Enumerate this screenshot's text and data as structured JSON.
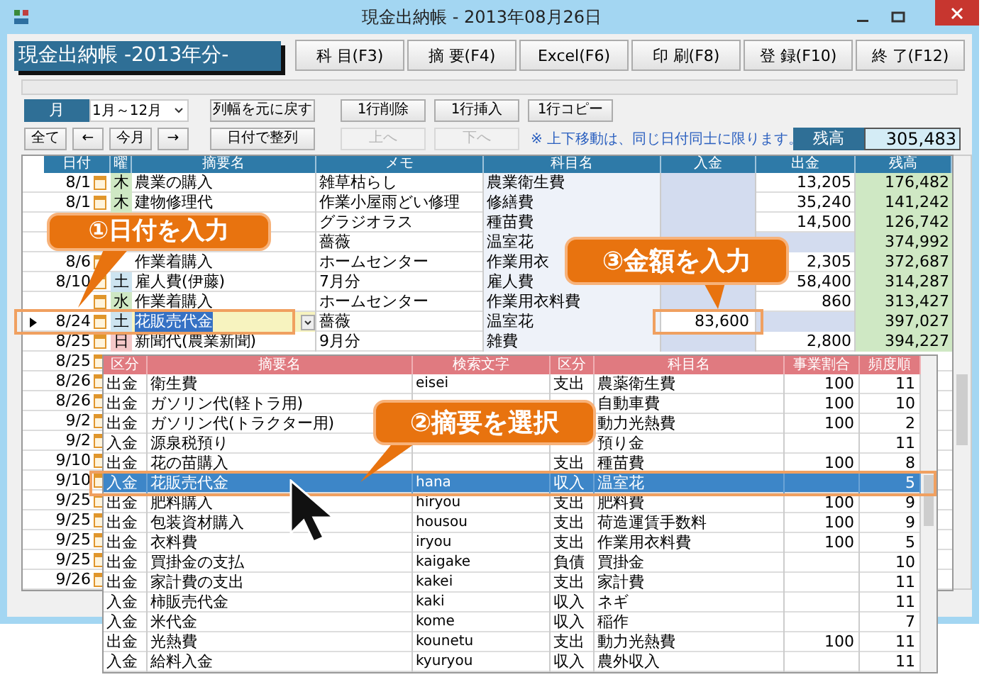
{
  "window": {
    "title": "現金出納帳 - 2013年08月26日"
  },
  "header": {
    "title": "現金出納帳 -2013年分-",
    "buttons": [
      "科 目(F3)",
      "摘 要(F4)",
      "Excel(F6)",
      "印 刷(F8)",
      "登 録(F10)",
      "終 了(F12)"
    ]
  },
  "toolbar": {
    "period_label": "月",
    "period_select": "1月～12月",
    "row1": [
      {
        "label": "列幅を元に戻す",
        "disabled": false
      },
      {
        "label": "1行削除",
        "disabled": false
      },
      {
        "label": "1行挿入",
        "disabled": false
      },
      {
        "label": "1行コピー",
        "disabled": false
      }
    ],
    "nav": [
      "全て",
      "←",
      "今月",
      "→"
    ],
    "row2": [
      {
        "label": "日付で整列",
        "disabled": false
      },
      {
        "label": "上へ",
        "disabled": true
      },
      {
        "label": "下へ",
        "disabled": true
      }
    ],
    "note": "※ 上下移動は、同じ日付同士に限ります。",
    "balance_label": "残高",
    "balance_value": "305,483"
  },
  "table": {
    "columns": [
      "日付",
      "曜",
      "摘要名",
      "メモ",
      "科目名",
      "入金",
      "出金",
      "残高"
    ],
    "rows": [
      {
        "date": "8/1",
        "weekday": "木",
        "color": "#cfe8c4",
        "summary": "農業の購入",
        "memo": "雑草枯らし",
        "subject": "農業衛生費",
        "deposit": "",
        "payment": "13,205",
        "balance": "176,482",
        "selected": false
      },
      {
        "date": "8/1",
        "weekday": "木",
        "color": "#cfe8c4",
        "summary": "建物修理代",
        "memo": "作業小屋雨どい修理",
        "subject": "修繕費",
        "deposit": "",
        "payment": "35,240",
        "balance": "141,242",
        "selected": false
      },
      {
        "memo": "グラジオラス",
        "subject": "種苗費",
        "payment": "14,500",
        "balance": "126,742",
        "selected": false
      },
      {
        "memo": "薔薇",
        "subject": "温室花",
        "balance": "374,992",
        "selected": false
      },
      {
        "date": "8/6",
        "summary": "作業着購入",
        "memo": "ホームセンター",
        "subject": "作業用衣",
        "payment": "2,305",
        "balance": "372,687",
        "selected": false
      },
      {
        "date": "8/10",
        "weekday": "土",
        "color": "#cde4f0",
        "summary": "雇人費(伊藤)",
        "memo": "7月分",
        "subject": "雇人費",
        "deposit": "",
        "payment": "58,400",
        "balance": "314,287",
        "selected": false
      },
      {
        "weekday": "水",
        "color": "#cfe8c4",
        "summary": "作業着購入",
        "memo": "ホームセンター",
        "subject": "作業用衣料費",
        "deposit": "",
        "payment": "860",
        "balance": "313,427",
        "selected": false
      },
      {
        "date": "8/24",
        "weekday": "土",
        "color": "#cde4f0",
        "summary": "花販売代金",
        "memo": "薔薇",
        "subject": "温室花",
        "deposit": "83,600",
        "payment": "",
        "balance": "397,027",
        "selected": true
      },
      {
        "date": "8/25",
        "weekday": "日",
        "color": "#f4c8c8",
        "summary": "新聞代(農業新聞)",
        "memo": "9月分",
        "subject": "雑費",
        "deposit": "",
        "payment": "2,800",
        "balance": "394,227",
        "selected": false
      },
      {
        "date": "8/25"
      },
      {
        "date": "8/26"
      },
      {
        "date": "8/26"
      },
      {
        "date": "9/2"
      },
      {
        "date": "9/2"
      },
      {
        "date": "9/10"
      },
      {
        "date": "9/10"
      },
      {
        "date": "9/25"
      },
      {
        "date": "9/25"
      },
      {
        "date": "9/25"
      },
      {
        "date": "9/25"
      },
      {
        "date": "9/26"
      }
    ]
  },
  "dropdown": {
    "columns": [
      "区分",
      "摘要名",
      "検索文字",
      "区分",
      "科目名",
      "事業割合",
      "頻度順"
    ],
    "rows": [
      {
        "type": "出金",
        "summary": "衛生費",
        "search": "eisei",
        "category": "支出",
        "subject": "農薬衛生費",
        "ratio": "100",
        "frequency": "11",
        "selected": false
      },
      {
        "type": "出金",
        "summary": "ガソリン代(軽トラ用)",
        "search": "",
        "category": "",
        "subject": "自動車費",
        "ratio": "100",
        "frequency": "10",
        "selected": false
      },
      {
        "type": "出金",
        "summary": "ガソリン代(トラクター用)",
        "search": "",
        "category": "",
        "subject": "動力光熱費",
        "ratio": "100",
        "frequency": "2",
        "selected": false
      },
      {
        "type": "入金",
        "summary": "源泉税預り",
        "search": "",
        "category": "",
        "subject": "預り金",
        "ratio": "",
        "frequency": "11",
        "selected": false
      },
      {
        "type": "出金",
        "summary": "花の苗購入",
        "search": "",
        "category": "支出",
        "subject": "種苗費",
        "ratio": "100",
        "frequency": "8",
        "selected": false
      },
      {
        "type": "入金",
        "summary": "花販売代金",
        "search": "hana",
        "category": "収入",
        "subject": "温室花",
        "ratio": "",
        "frequency": "5",
        "selected": true
      },
      {
        "type": "出金",
        "summary": "肥料購入",
        "search": "hiryou",
        "category": "支出",
        "subject": "肥料費",
        "ratio": "100",
        "frequency": "9",
        "selected": false
      },
      {
        "type": "出金",
        "summary": "包装資材購入",
        "search": "housou",
        "category": "支出",
        "subject": "荷造運賃手数料",
        "ratio": "100",
        "frequency": "9",
        "selected": false
      },
      {
        "type": "出金",
        "summary": "衣料費",
        "search": "iryou",
        "category": "支出",
        "subject": "作業用衣料費",
        "ratio": "100",
        "frequency": "5",
        "selected": false
      },
      {
        "type": "出金",
        "summary": "買掛金の支払",
        "search": "kaigake",
        "category": "負債",
        "subject": "買掛金",
        "ratio": "",
        "frequency": "10",
        "selected": false
      },
      {
        "type": "出金",
        "summary": "家計費の支出",
        "search": "kakei",
        "category": "支出",
        "subject": "家計費",
        "ratio": "",
        "frequency": "11",
        "selected": false
      },
      {
        "type": "入金",
        "summary": "柿販売代金",
        "search": "kaki",
        "category": "収入",
        "subject": "ネギ",
        "ratio": "",
        "frequency": "11",
        "selected": false
      },
      {
        "type": "入金",
        "summary": "米代金",
        "search": "kome",
        "category": "収入",
        "subject": "稲作",
        "ratio": "",
        "frequency": "7",
        "selected": false
      },
      {
        "type": "出金",
        "summary": "光熱費",
        "search": "kounetu",
        "category": "支出",
        "subject": "動力光熱費",
        "ratio": "100",
        "frequency": "11",
        "selected": false
      },
      {
        "type": "入金",
        "summary": "給料入金",
        "search": "kyuryou",
        "category": "収入",
        "subject": "農外収入",
        "ratio": "",
        "frequency": "11",
        "selected": false
      }
    ]
  },
  "callouts": [
    "①日付を入力",
    "②摘要を選択",
    "③金額を入力"
  ]
}
